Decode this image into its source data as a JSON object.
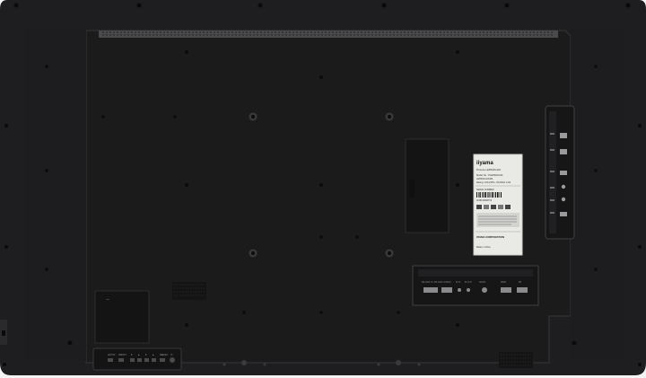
{
  "label": {
    "brand": "iiyama",
    "product_line": "ProLite LE5540UHS",
    "model_no_label": "Model No.: PLE5540UHS",
    "model_code": "LE5540UHS-B1",
    "rating": "Rating: 100-240V~ 50-60Hz 2.0A",
    "serial_caption": "SERIAL NUMBER",
    "serial_number": "1158134800573",
    "manufacturer": "IIYAMA CORPORATION",
    "origin": "Made in China"
  },
  "panel": {
    "bottom_input_labels": [
      "RS-232C IN",
      "RS-232C OUT",
      "LAN",
      "IR IN",
      "IR OUT",
      "AUDIO",
      "HDMI",
      "DP"
    ],
    "button_strip_labels": [
      "AUTO",
      "INPUT",
      "▾",
      "▴",
      "▾",
      "▴",
      "MENU",
      "⏻"
    ]
  },
  "colors": {
    "housing": "#1b1b1c",
    "recess": "#222223",
    "frame_outer": "#2c2c2e",
    "label_paper": "#e9e9e6",
    "background": "#f4f4f4"
  }
}
